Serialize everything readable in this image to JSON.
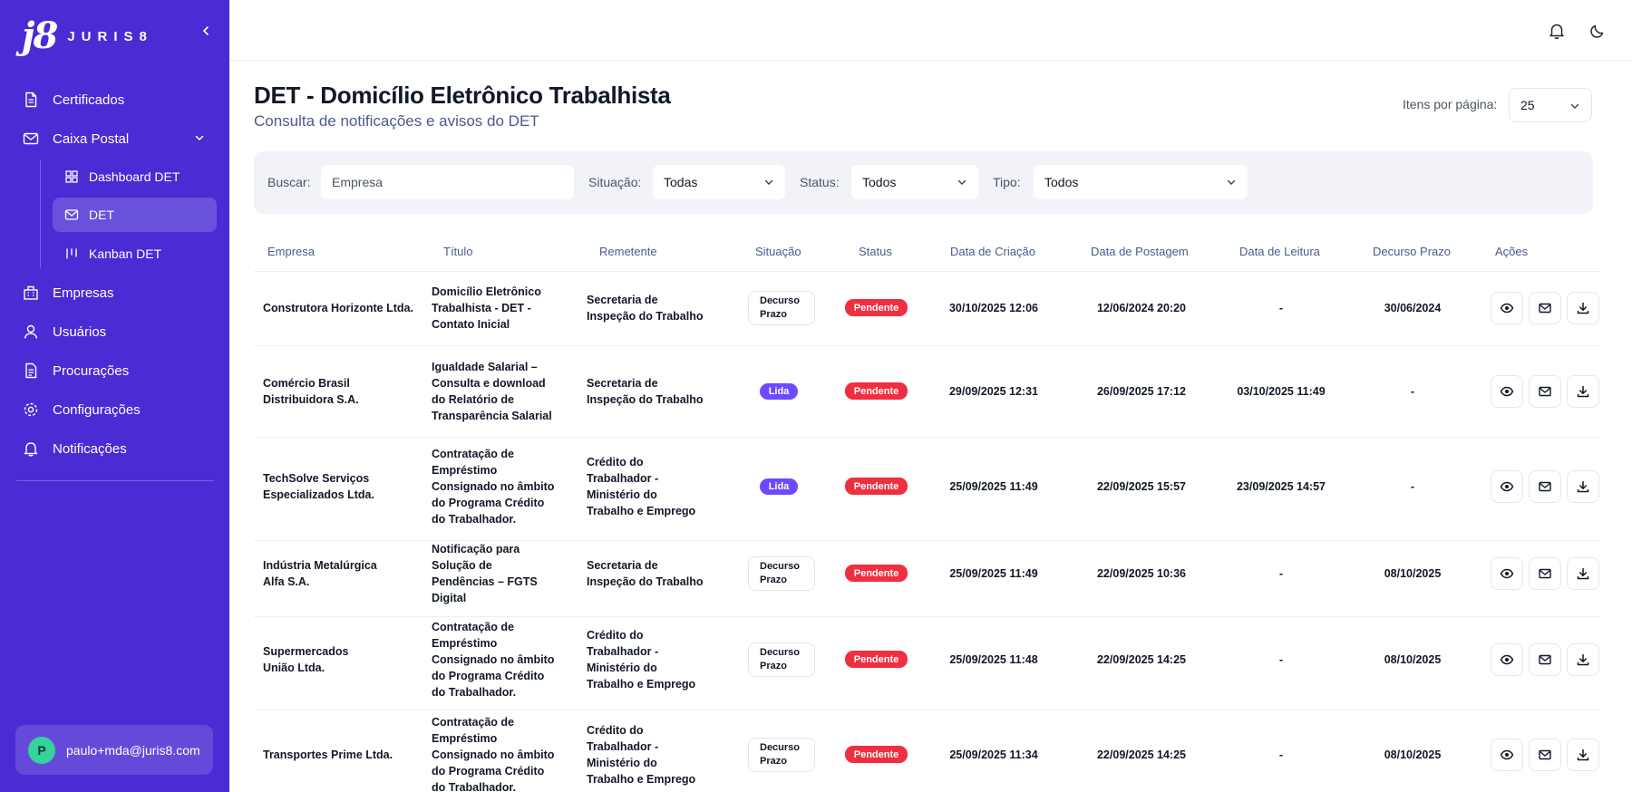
{
  "brand": {
    "mark": "j8",
    "name": "JURIS8"
  },
  "sidebar": {
    "items": [
      {
        "label": "Certificados",
        "icon": "file-icon"
      },
      {
        "label": "Caixa Postal",
        "icon": "mail-icon"
      },
      {
        "label": "Empresas",
        "icon": "building-icon"
      },
      {
        "label": "Usuários",
        "icon": "user-icon"
      },
      {
        "label": "Procurações",
        "icon": "document-icon"
      },
      {
        "label": "Configurações",
        "icon": "gear-icon"
      },
      {
        "label": "Notificações",
        "icon": "bell-icon"
      }
    ],
    "subitems": [
      {
        "label": "Dashboard DET",
        "icon": "grid-icon"
      },
      {
        "label": "DET",
        "icon": "mail-icon",
        "active": true
      },
      {
        "label": "Kanban DET",
        "icon": "kanban-icon"
      }
    ],
    "user": {
      "initial": "P",
      "email": "paulo+mda@juris8.com"
    }
  },
  "header": {
    "title": "DET - Domicílio Eletrônico Trabalhista",
    "subtitle": "Consulta de notificações e avisos do DET",
    "per_page_label": "Itens por página:",
    "per_page_value": "25"
  },
  "filters": {
    "search_label": "Buscar:",
    "search_placeholder": "Empresa",
    "situacao_label": "Situação:",
    "situacao_value": "Todas",
    "status_label": "Status:",
    "status_value": "Todos",
    "tipo_label": "Tipo:",
    "tipo_value": "Todos"
  },
  "table": {
    "columns": [
      "Empresa",
      "Título",
      "Remetente",
      "Situação",
      "Status",
      "Data de Criação",
      "Data de Postagem",
      "Data de Leitura",
      "Decurso Prazo",
      "Ações"
    ],
    "rows": [
      {
        "empresa": [
          "Construtora Horizonte Ltda."
        ],
        "titulo": [
          "Domicílio Eletrônico",
          "Trabalhista - DET -",
          "Contato Inicial"
        ],
        "remetente": [
          "Secretaria de",
          "Inspeção do Trabalho"
        ],
        "situacao": "Decurso Prazo",
        "situacao_lines": [
          "Decurso",
          "Prazo"
        ],
        "status": "Pendente",
        "criacao": "30/10/2025 12:06",
        "postagem": "12/06/2024 20:20",
        "leitura": "-",
        "decurso": "30/06/2024"
      },
      {
        "empresa": [
          "Comércio Brasil",
          "Distribuidora S.A."
        ],
        "titulo": [
          "Igualdade Salarial –",
          "Consulta e download",
          "do Relatório de",
          "Transparência Salarial"
        ],
        "remetente": [
          "Secretaria de",
          "Inspeção do Trabalho"
        ],
        "situacao": "Lida",
        "status": "Pendente",
        "criacao": "29/09/2025 12:31",
        "postagem": "26/09/2025 17:12",
        "leitura": "03/10/2025 11:49",
        "decurso": "-"
      },
      {
        "empresa": [
          "TechSolve Serviços",
          "Especializados Ltda."
        ],
        "titulo": [
          "Contratação de",
          "Empréstimo",
          "Consignado no âmbito",
          "do Programa Crédito",
          "do Trabalhador."
        ],
        "remetente": [
          "Crédito do",
          "Trabalhador -",
          "Ministério do",
          "Trabalho e Emprego"
        ],
        "situacao": "Lida",
        "status": "Pendente",
        "criacao": "25/09/2025 11:49",
        "postagem": "22/09/2025 15:57",
        "leitura": "23/09/2025 14:57",
        "decurso": "-"
      },
      {
        "empresa": [
          "Indústria Metalúrgica",
          "Alfa S.A."
        ],
        "titulo": [
          "Notificação para",
          "Solução de",
          "Pendências – FGTS",
          "Digital"
        ],
        "remetente": [
          "Secretaria de",
          "Inspeção do Trabalho"
        ],
        "situacao": "Decurso Prazo",
        "situacao_lines": [
          "Decurso",
          "Prazo"
        ],
        "status": "Pendente",
        "criacao": "25/09/2025 11:49",
        "postagem": "22/09/2025 10:36",
        "leitura": "-",
        "decurso": "08/10/2025"
      },
      {
        "empresa": [
          "Supermercados",
          "União Ltda."
        ],
        "titulo": [
          "Contratação de",
          "Empréstimo",
          "Consignado no âmbito",
          "do Programa Crédito",
          "do Trabalhador."
        ],
        "remetente": [
          "Crédito do",
          "Trabalhador -",
          "Ministério do",
          "Trabalho e Emprego"
        ],
        "situacao": "Decurso Prazo",
        "situacao_lines": [
          "Decurso",
          "Prazo"
        ],
        "status": "Pendente",
        "criacao": "25/09/2025 11:48",
        "postagem": "22/09/2025 14:25",
        "leitura": "-",
        "decurso": "08/10/2025"
      },
      {
        "empresa": [
          "Transportes Prime Ltda."
        ],
        "titulo": [
          "Contratação de",
          "Empréstimo",
          "Consignado no âmbito",
          "do Programa Crédito",
          "do Trabalhador."
        ],
        "remetente": [
          "Crédito do",
          "Trabalhador -",
          "Ministério do",
          "Trabalho e Emprego"
        ],
        "situacao": "Decurso Prazo",
        "situacao_lines": [
          "Decurso",
          "Prazo"
        ],
        "status": "Pendente",
        "criacao": "25/09/2025 11:34",
        "postagem": "22/09/2025 14:25",
        "leitura": "-",
        "decurso": "08/10/2025"
      }
    ],
    "actions": [
      {
        "name": "view-button",
        "icon": "eye-icon"
      },
      {
        "name": "mail-button",
        "icon": "mail-icon"
      },
      {
        "name": "download-button",
        "icon": "download-icon"
      }
    ]
  },
  "colors": {
    "sidebar": "#4a2bd4",
    "lida": "#6d4aff",
    "pendente": "#ef2f3f",
    "avatar": "#34d399"
  }
}
